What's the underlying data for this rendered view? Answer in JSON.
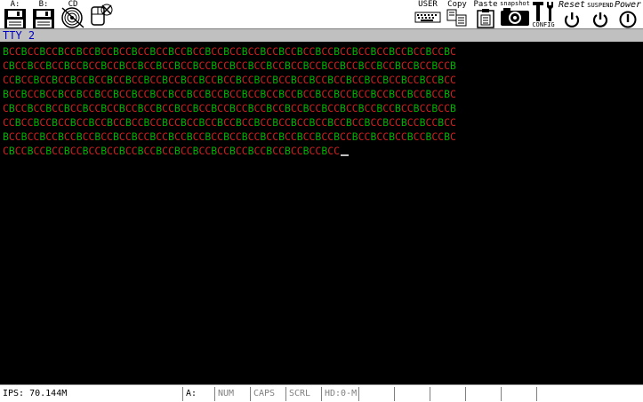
{
  "toolbar": {
    "floppy_a_label": "A:",
    "floppy_b_label": "B:",
    "cdrom_label": "CD",
    "user_label": "USER",
    "copy_label": "Copy",
    "paste_label": "Paste",
    "snapshot_label": "snapshot",
    "config_label": "CONFIG",
    "reset_label": "Reset",
    "suspend_label": "SUSPEND",
    "power_label": "Power"
  },
  "title": "TTY 2",
  "terminal": {
    "colors": {
      "B": "#00b000",
      "C": "#d02020"
    },
    "rows": [
      "BCCBCCBCCBCCBCCBCCBCCBCCBCCBCCBCCBCCBCCBCCBCCBCCBCCBCCBCCBCCBCCBCCBCCBCCBC",
      "CBCCBCCBCCBCCBCCBCCBCCBCCBCCBCCBCCBCCBCCBCCBCCBCCBCCBCCBCCBCCBCCBCCBCCBCCB",
      "CCBCCBCCBCCBCCBCCBCCBCCBCCBCCBCCBCCBCCBCCBCCBCCBCCBCCBCCBCCBCCBCCBCCBCCBCC",
      "BCCBCCBCCBCCBCCBCCBCCBCCBCCBCCBCCBCCBCCBCCBCCBCCBCCBCCBCCBCCBCCBCCBCCBCCBC",
      "CBCCBCCBCCBCCBCCBCCBCCBCCBCCBCCBCCBCCBCCBCCBCCBCCBCCBCCBCCBCCBCCBCCBCCBCCB",
      "CCBCCBCCBCCBCCBCCBCCBCCBCCBCCBCCBCCBCCBCCBCCBCCBCCBCCBCCBCCBCCBCCBCCBCCBCC",
      "BCCBCCBCCBCCBCCBCCBCCBCCBCCBCCBCCBCCBCCBCCBCCBCCBCCBCCBCCBCCBCCBCCBCCBCCBC",
      "CBCCBCCBCCBCCBCCBCCBCCBCCBCCBCCBCCBCCBCCBCCBCCBCCBCCBCC"
    ]
  },
  "status": {
    "ips": "IPS: 70.144M",
    "drive": "A:",
    "num": "NUM",
    "caps": "CAPS",
    "scrl": "SCRL",
    "hd": "HD:0-M"
  }
}
